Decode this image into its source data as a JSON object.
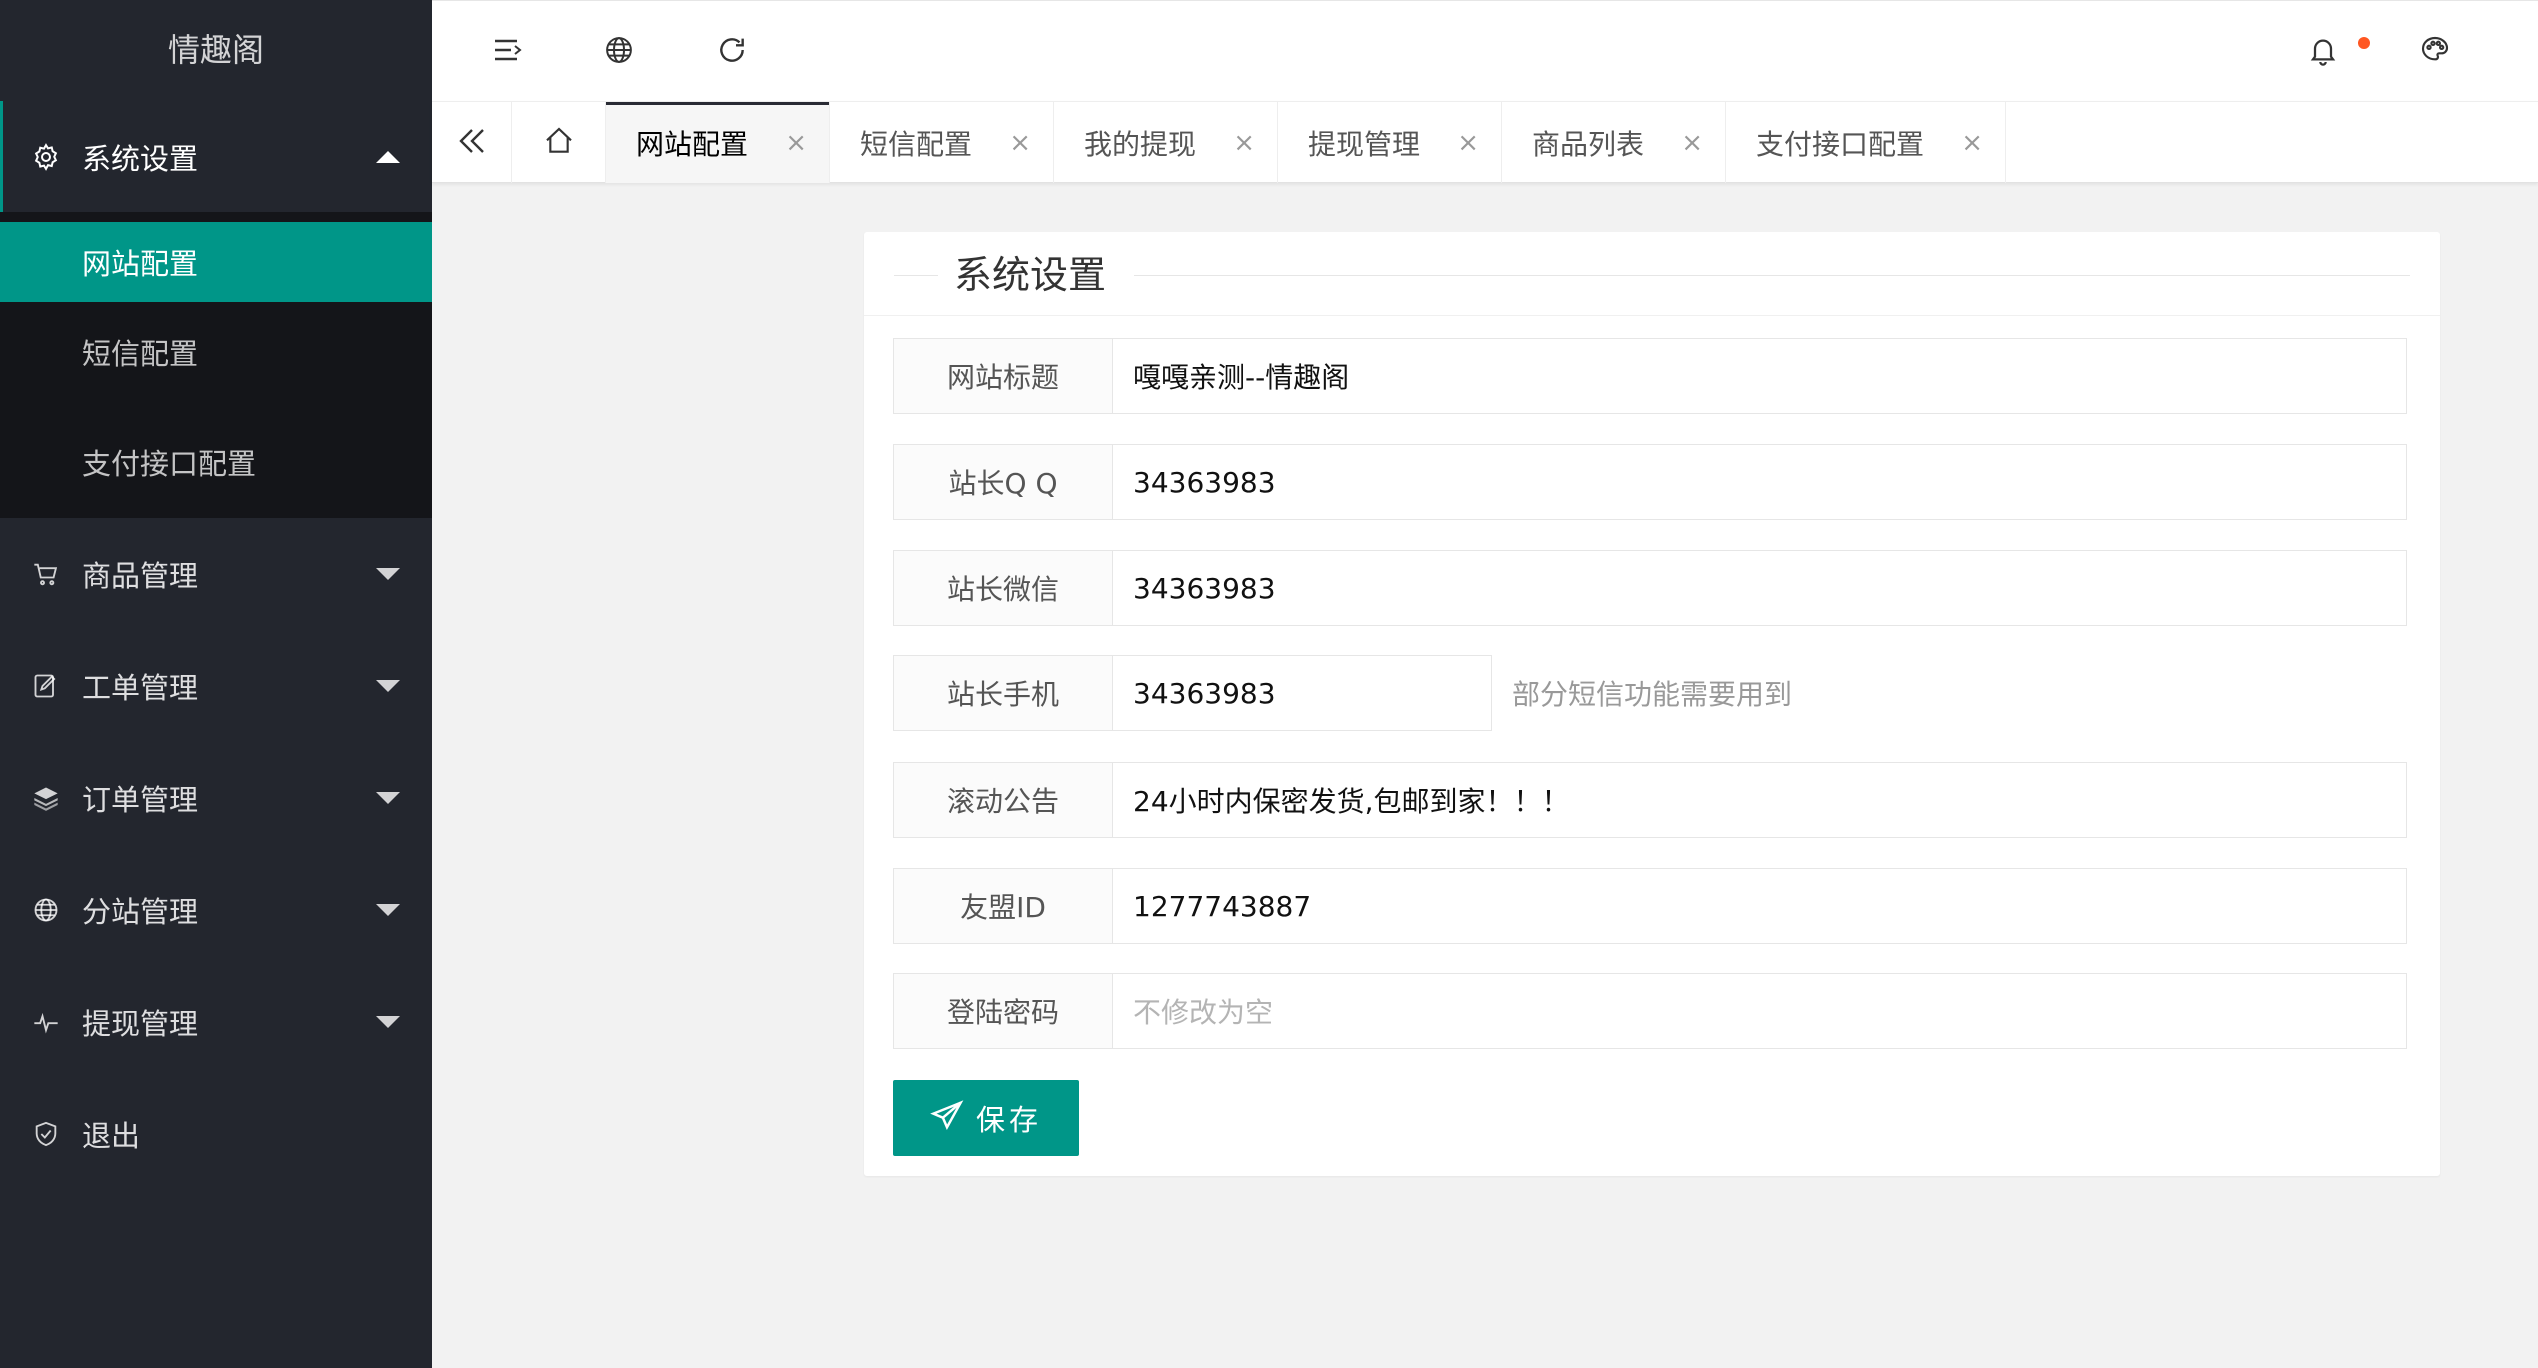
{
  "app": {
    "title": "情趣阁"
  },
  "colors": {
    "accent": "#009688",
    "sidebar": "#23262e",
    "notice_dot": "#ff5722"
  },
  "sidebar": {
    "groups": [
      {
        "label": "系统设置",
        "icon": "gear-icon",
        "open": true,
        "children": [
          {
            "label": "网站配置",
            "active": true
          },
          {
            "label": "短信配置"
          },
          {
            "label": "支付接口配置"
          }
        ]
      },
      {
        "label": "商品管理",
        "icon": "cart-icon"
      },
      {
        "label": "工单管理",
        "icon": "edit-icon"
      },
      {
        "label": "订单管理",
        "icon": "layers-icon"
      },
      {
        "label": "分站管理",
        "icon": "globe-icon"
      },
      {
        "label": "提现管理",
        "icon": "pulse-icon"
      },
      {
        "label": "退出",
        "icon": "shield-icon"
      }
    ]
  },
  "header": {
    "icons": [
      "menu-fold-icon",
      "globe-icon",
      "refresh-icon",
      "bell-icon",
      "palette-icon"
    ]
  },
  "tabs": [
    {
      "label": "网站配置",
      "active": true
    },
    {
      "label": "短信配置"
    },
    {
      "label": "我的提现"
    },
    {
      "label": "提现管理"
    },
    {
      "label": "商品列表"
    },
    {
      "label": "支付接口配置"
    }
  ],
  "form": {
    "legend": "系统设置",
    "fields": [
      {
        "label": "网站标题",
        "value": "嘎嘎亲测--情趣阁"
      },
      {
        "label": "站长Q Q",
        "value": "34363983"
      },
      {
        "label": "站长微信",
        "value": "34363983"
      },
      {
        "label": "站长手机",
        "value": "34363983",
        "aux": "部分短信功能需要用到"
      },
      {
        "label": "滚动公告",
        "value": "24小时内保密发货,包邮到家！！！"
      },
      {
        "label": "友盟ID",
        "value": "1277743887"
      },
      {
        "label": "登陆密码",
        "value": "",
        "placeholder": "不修改为空"
      }
    ],
    "save_label": "保存"
  }
}
